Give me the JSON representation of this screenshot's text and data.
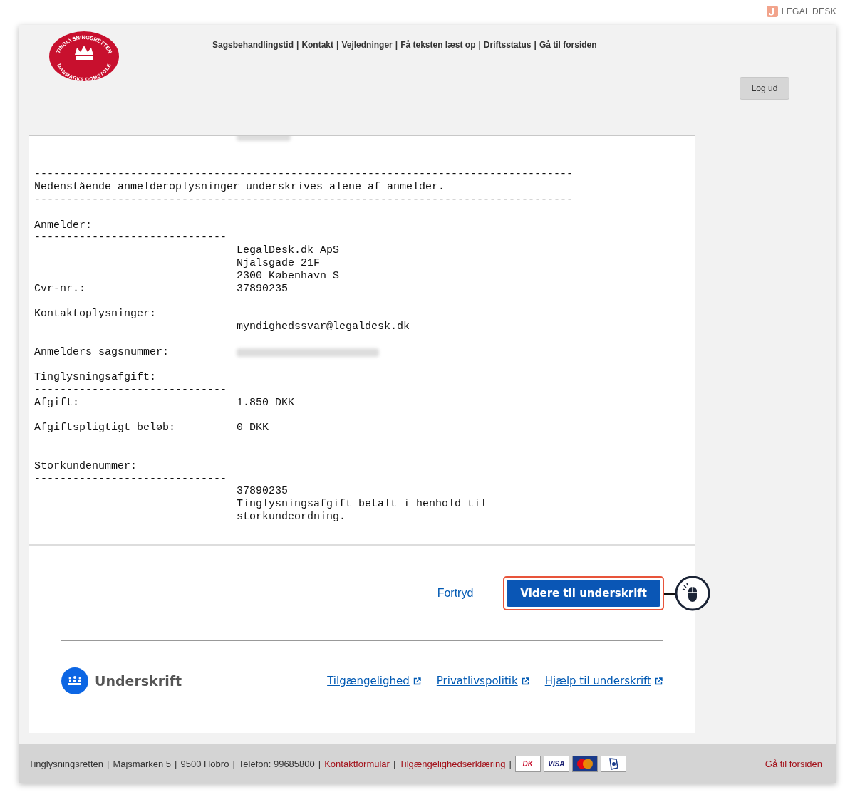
{
  "brand": {
    "label": "LEGAL DESK"
  },
  "logo": {
    "top_text": "TINGLYSNINGSRETTEN",
    "bottom_text": "DANMARKS DOMSTOLE"
  },
  "nav": [
    "Sagsbehandlingstid",
    "Kontakt",
    "Vejledninger",
    "Få teksten læst op",
    "Driftsstatus",
    "Gå til forsiden"
  ],
  "nav_separator": "|",
  "logout": "Log ud",
  "document": [
    {
      "kind": "redacted"
    },
    {
      "kind": "blank"
    },
    {
      "kind": "blank"
    },
    {
      "kind": "line",
      "text": "------------------------------------------------------------------------------------"
    },
    {
      "kind": "line",
      "text": "Nedenstående anmelderoplysninger underskrives alene af anmelder."
    },
    {
      "kind": "line",
      "text": "------------------------------------------------------------------------------------"
    },
    {
      "kind": "blank"
    },
    {
      "kind": "field",
      "label": "Anmelder:"
    },
    {
      "kind": "field",
      "label": "------------------------------"
    },
    {
      "kind": "field",
      "value": "LegalDesk.dk ApS"
    },
    {
      "kind": "field",
      "value": "Njalsgade 21F"
    },
    {
      "kind": "field",
      "value": "2300 København S"
    },
    {
      "kind": "field",
      "label": "Cvr-nr.:",
      "value": "37890235"
    },
    {
      "kind": "blank"
    },
    {
      "kind": "field",
      "label": "Kontaktoplysninger:"
    },
    {
      "kind": "field",
      "value": "myndighedssvar@legaldesk.dk"
    },
    {
      "kind": "blank"
    },
    {
      "kind": "redacted",
      "label": "Anmelders sagsnummer:"
    },
    {
      "kind": "blank"
    },
    {
      "kind": "field",
      "label": "Tinglysningsafgift:"
    },
    {
      "kind": "field",
      "label": "------------------------------"
    },
    {
      "kind": "field",
      "label": "Afgift:",
      "value": "1.850 DKK"
    },
    {
      "kind": "blank"
    },
    {
      "kind": "field",
      "label": "Afgiftspligtigt beløb:",
      "value": "0 DKK"
    },
    {
      "kind": "blank"
    },
    {
      "kind": "blank"
    },
    {
      "kind": "field",
      "label": "Storkundenummer:"
    },
    {
      "kind": "field",
      "label": "------------------------------"
    },
    {
      "kind": "field",
      "value": "37890235"
    },
    {
      "kind": "field",
      "value": "Tinglysningsafgift betalt i henhold til"
    },
    {
      "kind": "field",
      "value": "storkundeordning."
    }
  ],
  "actions": {
    "cancel": "Fortryd",
    "continue": "Videre til underskrift"
  },
  "signing": {
    "title": "Underskrift",
    "links": [
      "Tilgængelighed",
      "Privatlivspolitik",
      "Hjælp til underskrift"
    ]
  },
  "footer": {
    "separator": "|",
    "info": [
      "Tinglysningsretten",
      "Majsmarken 5",
      "9500 Hobro",
      "Telefon: 99685800"
    ],
    "links": [
      "Kontaktformular",
      "Tilgængelighedserklæring"
    ],
    "cards": [
      {
        "kind": "dk",
        "label": "DK"
      },
      {
        "kind": "visa",
        "label": "VISA"
      },
      {
        "kind": "mastercard"
      },
      {
        "kind": "other"
      }
    ],
    "home": "Gå til forsiden"
  }
}
